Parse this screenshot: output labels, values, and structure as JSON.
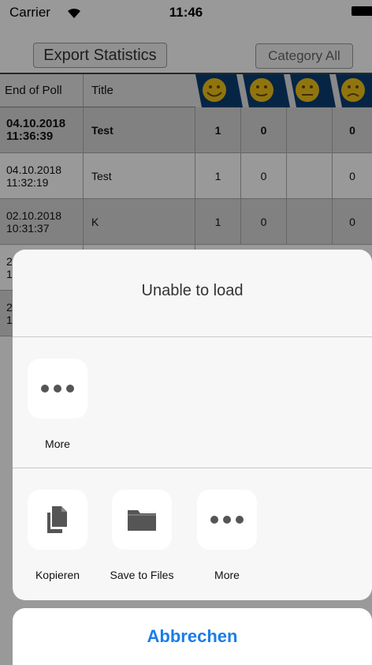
{
  "status_bar": {
    "carrier": "Carrier",
    "time": "11:46"
  },
  "toolbar": {
    "export_label": "Export Statistics",
    "category_label": "Category All"
  },
  "table": {
    "headers": {
      "end_of_poll": "End of Poll",
      "title": "Title"
    },
    "smiley_columns": [
      "very-happy-icon",
      "happy-icon",
      "neutral-icon",
      "sad-icon"
    ],
    "rows": [
      {
        "date": "04.10.2018",
        "time": "11:36:39",
        "title": "Test",
        "v1": "1",
        "v2": "0",
        "v3": "",
        "v4": "0"
      },
      {
        "date": "04.10.2018",
        "time": "11:32:19",
        "title": "Test",
        "v1": "1",
        "v2": "0",
        "v3": "",
        "v4": "0"
      },
      {
        "date": "02.10.2018",
        "time": "10:31:37",
        "title": "K",
        "v1": "1",
        "v2": "0",
        "v3": "",
        "v4": "0"
      },
      {
        "date": "2",
        "time": "1",
        "title": "",
        "v1": "",
        "v2": "",
        "v3": "",
        "v4": ""
      },
      {
        "date": "2",
        "time": "1",
        "title": "",
        "v1": "",
        "v2": "",
        "v3": "",
        "v4": ""
      }
    ]
  },
  "share_sheet": {
    "title": "Unable to load",
    "top_actions": [
      {
        "label": "More",
        "icon": "more-icon"
      }
    ],
    "bottom_actions": [
      {
        "label": "Kopieren",
        "icon": "copy-icon"
      },
      {
        "label": "Save to Files",
        "icon": "folder-icon"
      },
      {
        "label": "More",
        "icon": "more-icon"
      }
    ]
  },
  "cancel_label": "Abbrechen",
  "colors": {
    "accent": "#1a7de8",
    "header_band": "#0b3f73",
    "smiley": "#f0c419"
  }
}
